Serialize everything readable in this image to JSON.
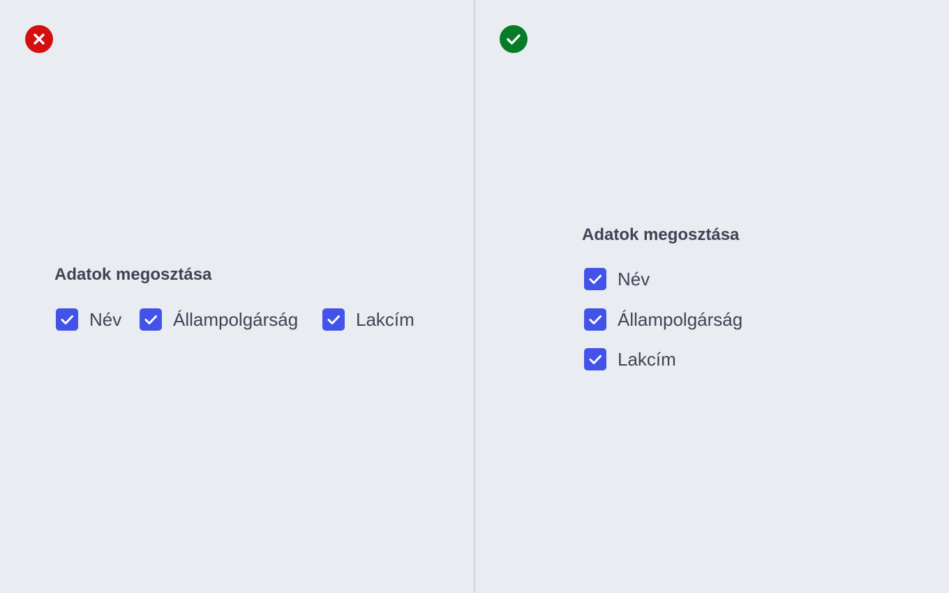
{
  "colors": {
    "background": "#e9ecf1",
    "text": "#3f4454",
    "checkbox": "#4353e8",
    "incorrect": "#d50f0f",
    "correct": "#077b26",
    "divider": "#d0d4da"
  },
  "incorrect_example": {
    "status_icon": "close-icon",
    "title": "Adatok megosztása",
    "layout": "horizontal",
    "options": [
      {
        "label": "Név",
        "checked": true
      },
      {
        "label": "Állampolgárság",
        "checked": true
      },
      {
        "label": "Lakcím",
        "checked": true
      }
    ]
  },
  "correct_example": {
    "status_icon": "check-icon",
    "title": "Adatok megosztása",
    "layout": "vertical",
    "options": [
      {
        "label": "Név",
        "checked": true
      },
      {
        "label": "Állampolgárság",
        "checked": true
      },
      {
        "label": "Lakcím",
        "checked": true
      }
    ]
  }
}
